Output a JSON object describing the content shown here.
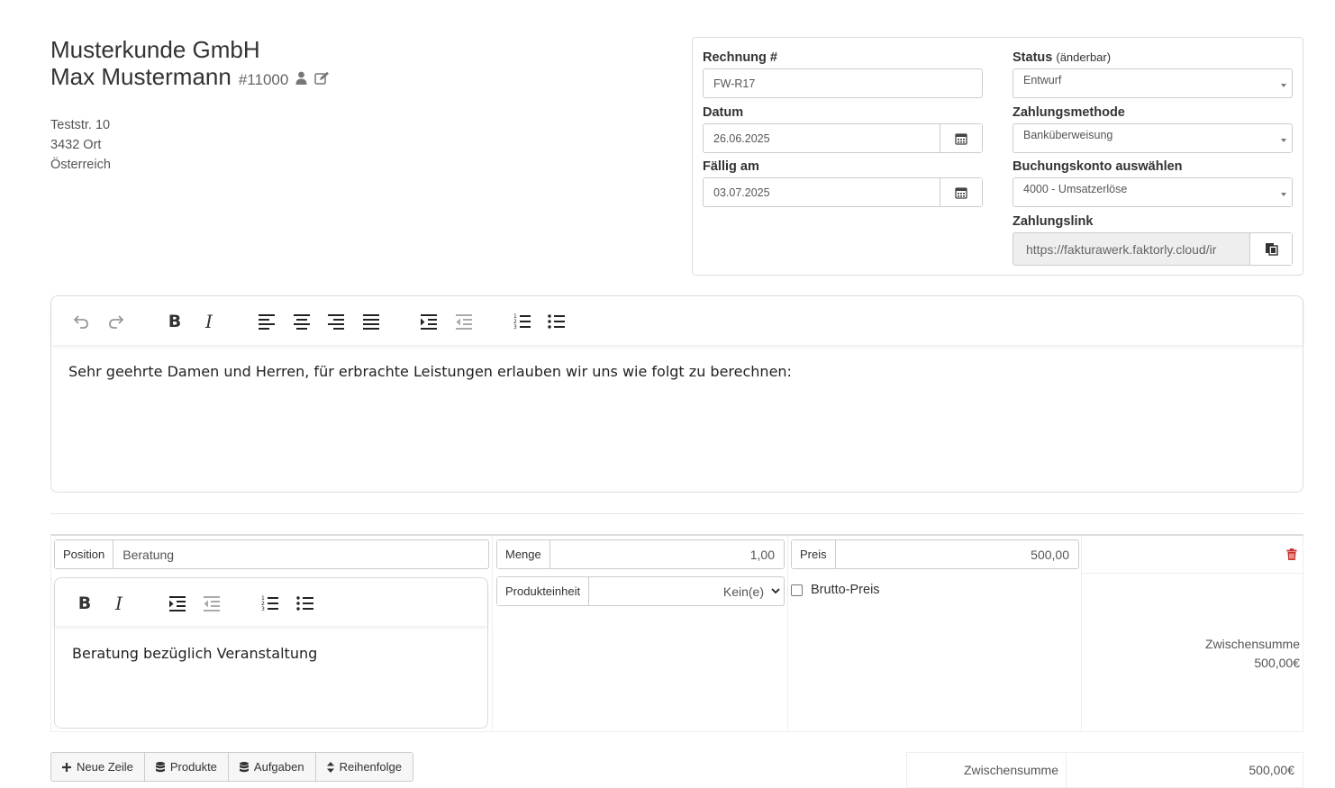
{
  "customer": {
    "company": "Musterkunde GmbH",
    "name": "Max Mustermann",
    "number": "#11000",
    "street": "Teststr. 10",
    "city": "3432 Ort",
    "country": "Österreich"
  },
  "invoice": {
    "number_label": "Rechnung #",
    "number_value": "FW-R17",
    "date_label": "Datum",
    "date_value": "26.06.2025",
    "due_label": "Fällig am",
    "due_value": "03.07.2025",
    "status_label": "Status",
    "status_hint": "(änderbar)",
    "status_value": "Entwurf",
    "payment_label": "Zahlungsmethode",
    "payment_value": "Banküberweisung",
    "account_label": "Buchungskonto auswählen",
    "account_value": "4000 -  Umsatzerlöse",
    "paylink_label": "Zahlungslink",
    "paylink_value": "https://fakturawerk.faktorly.cloud/ir"
  },
  "intro_text": "Sehr geehrte Damen und Herren, für erbrachte Leistungen erlauben wir uns wie folgt zu berechnen:",
  "line_item": {
    "position_label": "Position",
    "position_value": "Beratung",
    "description": "Beratung bezüglich Veranstaltung",
    "quantity_label": "Menge",
    "quantity_value": "1,00",
    "unit_label": "Produkteinheit",
    "unit_value": "Kein(e)",
    "price_label": "Preis",
    "price_value": "500,00",
    "gross_label": "Brutto-Preis",
    "subtotal_label": "Zwischensumme",
    "subtotal_value": "500,00€"
  },
  "buttons": {
    "new_row": "Neue Zeile",
    "products": "Produkte",
    "tasks": "Aufgaben",
    "order": "Reihenfolge"
  },
  "totals": {
    "subtotal_label": "Zwischensumme",
    "subtotal_value": "500,00€"
  },
  "colors": {
    "danger": "#c9302c",
    "border": "#cccccc",
    "readonly_bg": "#eeeeee"
  }
}
